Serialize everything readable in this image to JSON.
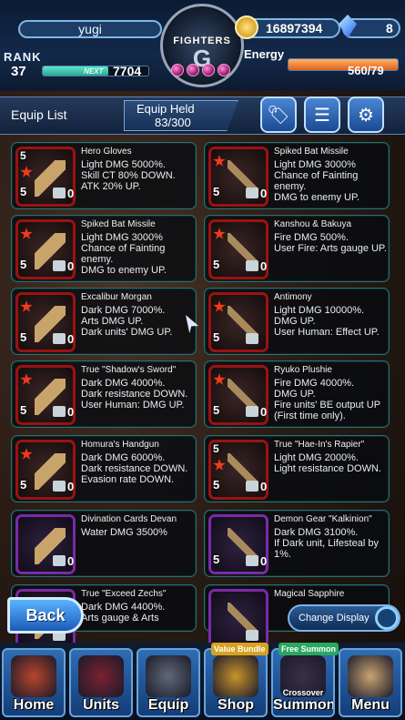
{
  "hud": {
    "player_name": "yugi",
    "rank_label": "RANK",
    "rank_value": "37",
    "next_label": "NEXT",
    "next_value": "7704",
    "exp_progress": 0.62,
    "logo_text": "FIGHTERS",
    "gil": "16897394",
    "gems": "8",
    "energy_label": "Energy",
    "energy_value": "560/79",
    "energy_progress": 1.0
  },
  "header": {
    "title": "Equip List",
    "held_label": "Equip Held",
    "held_value": "83/300",
    "buttons": [
      {
        "name": "tag-button",
        "icon": "tag-icon",
        "glyph": "🏷"
      },
      {
        "name": "filter-button",
        "icon": "filter-sliders-icon",
        "glyph": "☰"
      },
      {
        "name": "settings-button",
        "icon": "gear-icon",
        "glyph": "⚙"
      }
    ]
  },
  "equipment": [
    {
      "title": "Hero Gloves",
      "desc": "Light DMG 5000%.\nSkill CT 80% DOWN.\nATK 20% UP.",
      "rank_top": "5",
      "rank": "5",
      "count": "0",
      "frame": "red",
      "icon": "gloves-icon"
    },
    {
      "title": "Spiked Bat Missile",
      "desc": "Light DMG 3000%\nChance of Fainting enemy.\nDMG to enemy UP.",
      "rank_top": "",
      "rank": "5",
      "count": "0",
      "frame": "red",
      "icon": "spiked-bat-icon"
    },
    {
      "title": "Spiked Bat Missile",
      "desc": "Light DMG 3000%\nChance of Fainting enemy.\nDMG to enemy UP.",
      "rank_top": "",
      "rank": "5",
      "count": "0",
      "frame": "red",
      "icon": "spiked-bat-icon"
    },
    {
      "title": "Kanshou & Bakuya",
      "desc": "Fire DMG 500%.\nUser Fire: Arts gauge UP.",
      "rank_top": "",
      "rank": "5",
      "count": "0",
      "frame": "red",
      "icon": "twin-swords-icon"
    },
    {
      "title": "Excalibur Morgan",
      "desc": "Dark DMG 7000%.\nArts DMG UP.\nDark units' DMG UP.",
      "rank_top": "",
      "rank": "5",
      "count": "0",
      "frame": "red",
      "icon": "sword-icon"
    },
    {
      "title": "Antimony",
      "desc": "Light DMG 10000%.\nDMG UP.\nUser Human: Effect UP.",
      "rank_top": "",
      "rank": "5",
      "count": "",
      "frame": "red",
      "icon": "lance-icon"
    },
    {
      "title": "True \"Shadow's Sword\"",
      "desc": "Dark DMG 4000%.\nDark resistance DOWN.\nUser Human: DMG UP.",
      "rank_top": "",
      "rank": "5",
      "count": "0",
      "frame": "red",
      "icon": "shadow-sword-icon"
    },
    {
      "title": "Ryuko Plushie",
      "desc": "Fire DMG 4000%.\nDMG UP.\nFire units' BE output UP (First time only).",
      "rank_top": "",
      "rank": "5",
      "count": "0",
      "frame": "red",
      "icon": "plushie-icon"
    },
    {
      "title": "Homura's Handgun",
      "desc": "Dark DMG 6000%.\nDark resistance DOWN.\nEvasion rate DOWN.",
      "rank_top": "",
      "rank": "5",
      "count": "0",
      "frame": "red",
      "icon": "handgun-icon"
    },
    {
      "title": "True \"Hae-In's Rapier\"",
      "desc": "Light DMG 2000%.\nLight resistance DOWN.",
      "rank_top": "5",
      "rank": "5",
      "count": "0",
      "frame": "red",
      "icon": "rapier-icon"
    },
    {
      "title": "Divination Cards Devan",
      "desc": "Water DMG 3500%",
      "rank_top": "",
      "rank": "",
      "count": "0",
      "frame": "purple",
      "icon": "cards-icon"
    },
    {
      "title": "Demon Gear \"Kalkinion\"",
      "desc": "Dark DMG 3100%.\nIf Dark unit, Lifesteal by 1%.",
      "rank_top": "",
      "rank": "5",
      "count": "0",
      "frame": "purple",
      "icon": "demon-gear-icon"
    },
    {
      "title": "True \"Exceed Zechs\"",
      "desc": "Dark DMG 4400%.\nArts gauge & Arts",
      "rank_top": "",
      "rank": "",
      "count": "",
      "frame": "purple",
      "icon": "exceed-icon"
    },
    {
      "title": "Magical Sapphire",
      "desc": "",
      "rank_top": "",
      "rank": "",
      "count": "",
      "frame": "purple",
      "icon": "sapphire-icon"
    }
  ],
  "footer": {
    "back_label": "Back",
    "change_display_label": "Change Display"
  },
  "nav": [
    {
      "label": "Home",
      "icon": "house-icon",
      "badge": ""
    },
    {
      "label": "Units",
      "icon": "units-icon",
      "badge": ""
    },
    {
      "label": "Equip",
      "icon": "equip-icon",
      "badge": ""
    },
    {
      "label": "Shop",
      "icon": "shop-chest-icon",
      "badge": "Value Bundle"
    },
    {
      "label": "Summon",
      "icon": "summon-icon",
      "badge": "Free Summon",
      "sublabel": "Crossover"
    },
    {
      "label": "Menu",
      "icon": "book-icon",
      "badge": ""
    }
  ]
}
